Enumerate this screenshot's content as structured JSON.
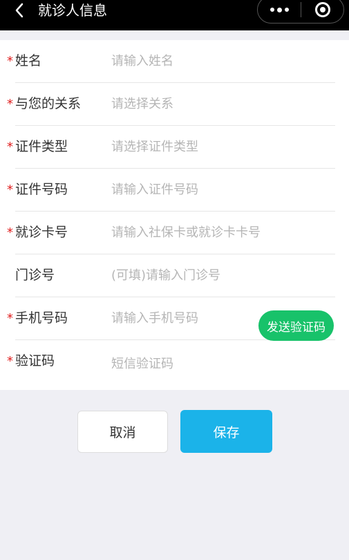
{
  "navbar": {
    "title": "就诊人信息",
    "back_icon": "chevron-left-icon",
    "more_icon": "more-dots-icon",
    "close_icon": "target-circle-icon"
  },
  "form": {
    "rows": [
      {
        "required": true,
        "label": "姓名",
        "placeholder": "请输入姓名",
        "value": ""
      },
      {
        "required": true,
        "label": "与您的关系",
        "placeholder": "请选择关系",
        "value": ""
      },
      {
        "required": true,
        "label": "证件类型",
        "placeholder": "请选择证件类型",
        "value": ""
      },
      {
        "required": true,
        "label": "证件号码",
        "placeholder": "请输入证件号码",
        "value": ""
      },
      {
        "required": true,
        "label": "就诊卡号",
        "placeholder": "请输入社保卡或就诊卡卡号",
        "value": ""
      },
      {
        "required": false,
        "label": "门诊号",
        "placeholder": "(可填)请输入门诊号",
        "value": ""
      },
      {
        "required": true,
        "label": "手机号码",
        "placeholder": "请输入手机号码",
        "value": ""
      },
      {
        "required": true,
        "label": "验证码",
        "placeholder": "短信验证码",
        "value": ""
      }
    ],
    "required_mark": "*",
    "send_code_label": "发送验证码"
  },
  "actions": {
    "cancel_label": "取消",
    "save_label": "保存"
  },
  "colors": {
    "accent_save": "#1bb3e9",
    "send_code": "#18c26a",
    "required": "#e02020"
  }
}
